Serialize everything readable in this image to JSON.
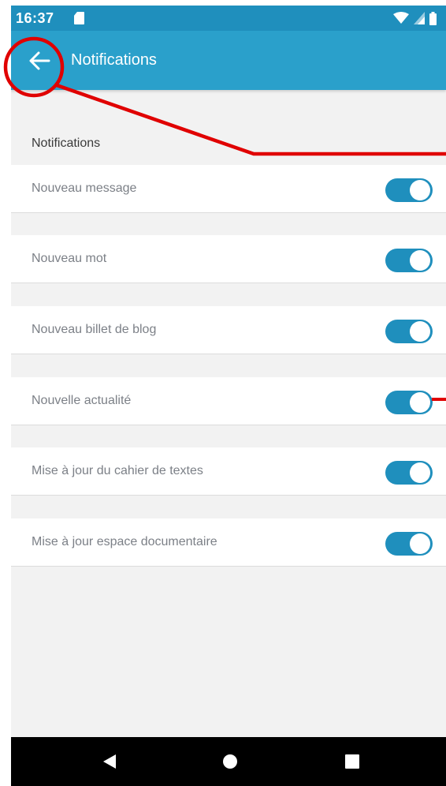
{
  "status_bar": {
    "time": "16:37",
    "icons": [
      "sd-card-icon",
      "wifi-icon",
      "signal-icon",
      "battery-icon"
    ]
  },
  "app_bar": {
    "title": "Notifications",
    "back_icon": "arrow-back-icon"
  },
  "section": {
    "title": "Notifications"
  },
  "settings": [
    {
      "label": "Nouveau message",
      "enabled": true
    },
    {
      "label": "Nouveau mot",
      "enabled": true
    },
    {
      "label": "Nouveau billet de blog",
      "enabled": true
    },
    {
      "label": "Nouvelle actualité",
      "enabled": true
    },
    {
      "label": "Mise à jour du cahier de textes",
      "enabled": true
    },
    {
      "label": "Mise à jour espace documentaire",
      "enabled": true
    }
  ],
  "nav_bar": {
    "buttons": [
      "back-triangle-icon",
      "home-circle-icon",
      "recents-square-icon"
    ]
  },
  "colors": {
    "status_bar": "#1f8fbd",
    "app_bar": "#2aa0cb",
    "toggle_on": "#1f8fbd",
    "annotation": "#e00000",
    "background": "#f2f2f2"
  }
}
